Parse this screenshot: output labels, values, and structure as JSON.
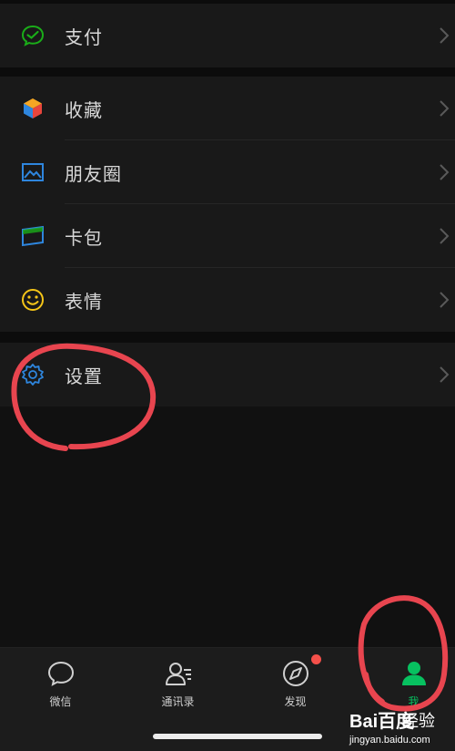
{
  "menu": {
    "pay": {
      "label": "支付",
      "icon": "wechat-pay-icon",
      "color": "#1aad19"
    },
    "favorites": {
      "label": "收藏",
      "icon": "cube-icon",
      "color": "#f5a623"
    },
    "moments": {
      "label": "朋友圈",
      "icon": "image-icon",
      "color": "#2e86de"
    },
    "cards": {
      "label": "卡包",
      "icon": "card-icon",
      "color": "#2e86de"
    },
    "stickers": {
      "label": "表情",
      "icon": "smile-icon",
      "color": "#f5c518"
    },
    "settings": {
      "label": "设置",
      "icon": "gear-icon",
      "color": "#2e86de"
    }
  },
  "tabbar": {
    "tabs": [
      {
        "label": "微信",
        "icon": "chat-bubble-icon",
        "active": false
      },
      {
        "label": "通讯录",
        "icon": "contacts-icon",
        "active": false
      },
      {
        "label": "发现",
        "icon": "compass-icon",
        "active": false,
        "badge": true
      },
      {
        "label": "我",
        "icon": "person-icon",
        "active": true
      }
    ],
    "active_color": "#07c160",
    "badge_color": "#f4504a"
  },
  "watermark": {
    "logo": "Bai百度",
    "logo2": "经验",
    "url": "jingyan.baidu.com"
  }
}
